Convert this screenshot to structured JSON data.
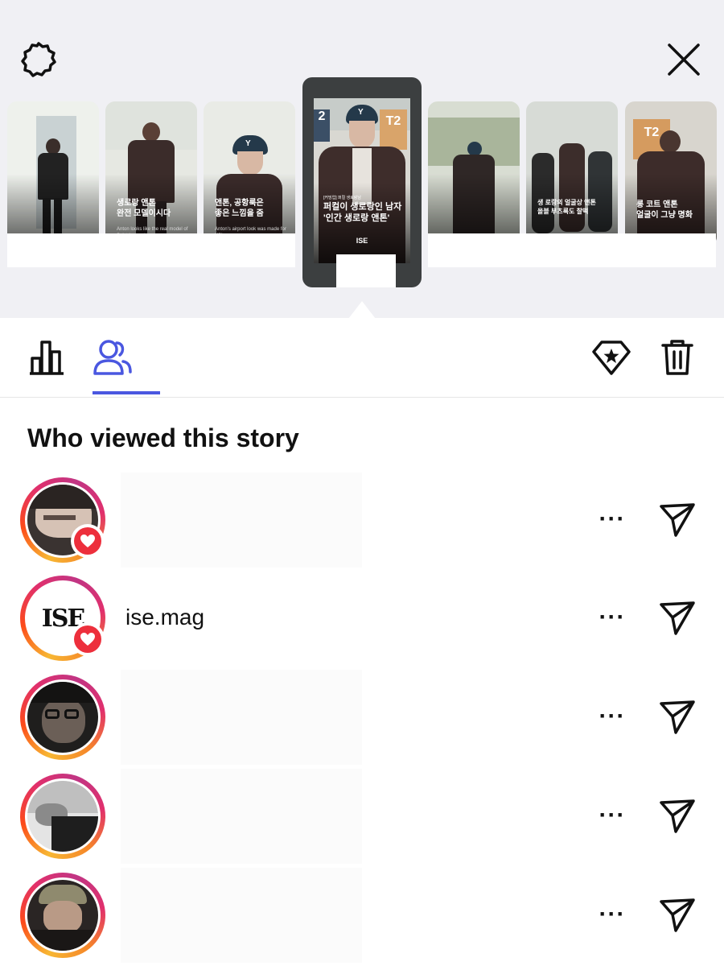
{
  "header": {
    "settings_icon": "gear-icon",
    "close_icon": "close-icon"
  },
  "stories": [
    {
      "caption": "",
      "footnote": ""
    },
    {
      "caption": "생로랑 앤톤\n완전 모델이시다",
      "footnote": "Anton looks like the real model of Saint Laurent"
    },
    {
      "caption": "앤톤, 공항룩은\n좋은 느낌을 줌",
      "footnote": "Anton's airport look was made for YSL"
    },
    {
      "caption": "퍼컬이 생로랑인 남자\n'인간 생로랑 앤톤'",
      "footnote": "",
      "kicker": "[커밍업] 퍼컬 생로랑남",
      "brand": "ISE"
    },
    {
      "caption": "",
      "footnote": ""
    },
    {
      "caption": "생 로랑의 얼굴상 앤톤\n올블 부츠룩도 찰떡",
      "footnote": ""
    },
    {
      "caption": "롱 코트 앤톤\n얼굴이 그냥 명화",
      "footnote": ""
    }
  ],
  "toolbar": {
    "insights_icon": "bar-chart-icon",
    "viewers_icon": "people-icon",
    "highlight_icon": "highlight-star-icon",
    "delete_icon": "trash-icon"
  },
  "viewers_section": {
    "title": "Who viewed this story",
    "more_label": "···",
    "viewers": [
      {
        "username": "",
        "liked": true
      },
      {
        "username": "ise.mag",
        "liked": true
      },
      {
        "username": "",
        "liked": false
      },
      {
        "username": "",
        "liked": false
      },
      {
        "username": "",
        "liked": false
      }
    ]
  },
  "colors": {
    "accent": "#4a57e0",
    "heart": "#ed2f3c",
    "ring_start": "#f7b733",
    "ring_end": "#c13584"
  }
}
